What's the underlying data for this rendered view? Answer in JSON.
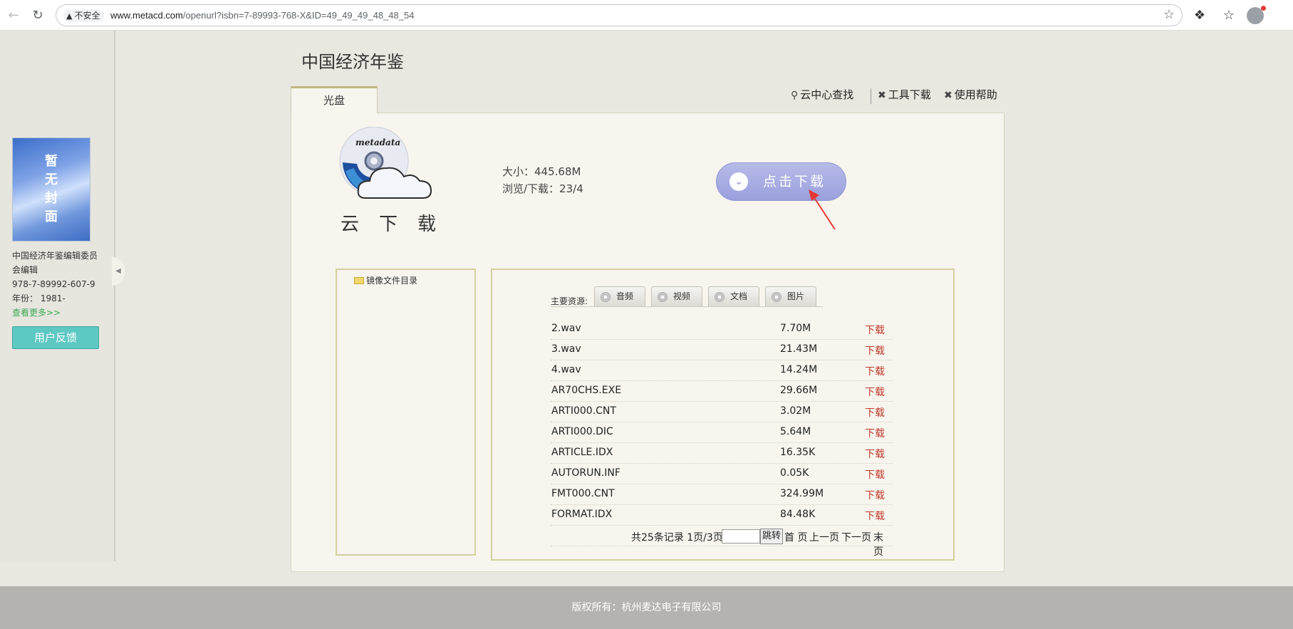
{
  "browser": {
    "security_label": "不安全",
    "url_host": "www.metacd.com",
    "url_path": "/openurl?isbn=7-89993-768-X&ID=49_49_49_48_48_54"
  },
  "sidebar": {
    "cover_text": "暂无封面",
    "editor": "中国经济年鉴编辑委员会编辑",
    "isbn": "978-7-89992-607-9",
    "year": "年份： 1981-",
    "more_link": "查看更多>>",
    "feedback_label": "用户反馈"
  },
  "main": {
    "title": "中国经济年鉴",
    "tab_label": "光盘",
    "links": {
      "cloud_search": "云中心查找",
      "tool_download": "工具下载",
      "help": "使用帮助"
    },
    "cloud_logo_text": "metadata",
    "cloud_label": "云下载",
    "size": "大小：445.68M",
    "views": "浏览/下载：23/4",
    "download_button": "点击下载",
    "tree_root": "镜像文件目录",
    "resources_label": "主要资源:",
    "resource_tabs": [
      "音频",
      "视频",
      "文档",
      "图片"
    ],
    "files": [
      {
        "name": "2.wav",
        "size": "7.70M",
        "action": "下载"
      },
      {
        "name": "3.wav",
        "size": "21.43M",
        "action": "下载"
      },
      {
        "name": "4.wav",
        "size": "14.24M",
        "action": "下载"
      },
      {
        "name": "AR70CHS.EXE",
        "size": "29.66M",
        "action": "下载"
      },
      {
        "name": "ARTI000.CNT",
        "size": "3.02M",
        "action": "下载"
      },
      {
        "name": "ARTI000.DIC",
        "size": "5.64M",
        "action": "下载"
      },
      {
        "name": "ARTICLE.IDX",
        "size": "16.35K",
        "action": "下载"
      },
      {
        "name": "AUTORUN.INF",
        "size": "0.05K",
        "action": "下载"
      },
      {
        "name": "FMT000.CNT",
        "size": "324.99M",
        "action": "下载"
      },
      {
        "name": "FORMAT.IDX",
        "size": "84.48K",
        "action": "下载"
      }
    ],
    "pager": {
      "total": "共25条记录 1页/3页",
      "go": "跳转",
      "first": "首 页",
      "prev": "上一页",
      "next": "下一页",
      "last": "末页"
    }
  },
  "footer": {
    "copyright": "版权所有：杭州麦达电子有限公司"
  },
  "colors": {
    "download_link": "#c0392b",
    "feedback_button": "#5ec8c3",
    "download_button": "#9aa0dd"
  }
}
